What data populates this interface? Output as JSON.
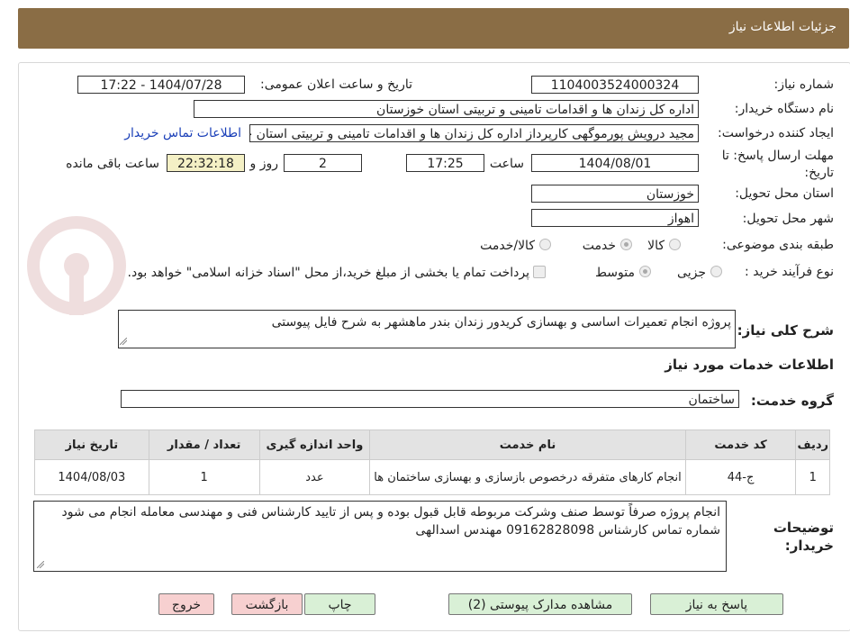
{
  "header": {
    "title": "جزئیات اطلاعات نیاز"
  },
  "form": {
    "need_number_label": "شماره نیاز:",
    "need_number": "1104003524000324",
    "announce_label": "تاریخ و ساعت اعلان عمومی:",
    "announce_value": "1404/07/28 - 17:22",
    "buyer_org_label": "نام دستگاه خریدار:",
    "buyer_org": "اداره کل زندان ها و اقدامات تامینی و تربیتی استان خوزستان",
    "creator_label": "ایجاد کننده درخواست:",
    "creator": "مجید درویش پورموگهی کارپرداز اداره کل زندان ها و اقدامات تامینی و تربیتی استان خوزستان",
    "contact_link": "اطلاعات تماس خریدار",
    "deadline_label_1": "مهلت ارسال پاسخ: تا",
    "deadline_label_2": "تاریخ:",
    "deadline_date": "1404/08/01",
    "hour_label": "ساعت",
    "deadline_time": "17:25",
    "days_value": "2",
    "days_label": "روز و",
    "remaining_time": "22:32:18",
    "remaining_label": "ساعت باقی مانده",
    "province_label": "استان محل تحویل:",
    "province": "خوزستان",
    "city_label": "شهر محل تحویل:",
    "city": "اهواز",
    "category_label": "طبقه بندی موضوعی:",
    "category_options": [
      "کالا",
      "خدمت",
      "کالا/خدمت"
    ],
    "category_selected": "خدمت",
    "process_label": "نوع فرآیند خرید :",
    "process_options": [
      "جزیی",
      "متوسط"
    ],
    "process_selected": "متوسط",
    "payment_note": "پرداخت تمام یا بخشی از مبلغ خرید،از محل \"اسناد خزانه اسلامی\" خواهد بود.",
    "general_desc_label": "شرح کلی نیاز:",
    "general_desc": "پروژه انجام تعمیرات اساسی و بهسازی کریدور زندان بندر ماهشهر به شرح فایل پیوستی",
    "services_title": "اطلاعات خدمات مورد نیاز",
    "service_group_label": "گروه خدمت:",
    "service_group": "ساختمان"
  },
  "table": {
    "headers": [
      "ردیف",
      "کد خدمت",
      "نام خدمت",
      "واحد اندازه گیری",
      "تعداد / مقدار",
      "تاریخ نیاز"
    ],
    "rows": [
      [
        "1",
        "ج-44",
        "انجام کارهای متفرقه درخصوص بازسازی و بهسازی ساختمان ها",
        "عدد",
        "1",
        "1404/08/03"
      ]
    ]
  },
  "buyer_notes_label_1": "توضیحات",
  "buyer_notes_label_2": "خریدار:",
  "buyer_notes": "انجام پروژه صرفاً توسط صنف وشرکت مربوطه قابل قبول بوده و پس از تایید کارشناس فنی و مهندسی معامله انجام می شود شماره تماس کارشناس 09162828098 مهندس اسدالهی",
  "buttons": {
    "reply": "پاسخ به نیاز",
    "attachments": "مشاهده مدارک پیوستی (2)",
    "print": "چاپ",
    "back": "بازگشت",
    "exit": "خروج"
  },
  "watermark_icon": "anatender-logo",
  "colors": {
    "header": "#8a6d45",
    "yellow": "#f4f0c5",
    "link": "#1a3fb8",
    "green_btn": "#d9f0d6",
    "pink_btn": "#f7d0d0"
  }
}
